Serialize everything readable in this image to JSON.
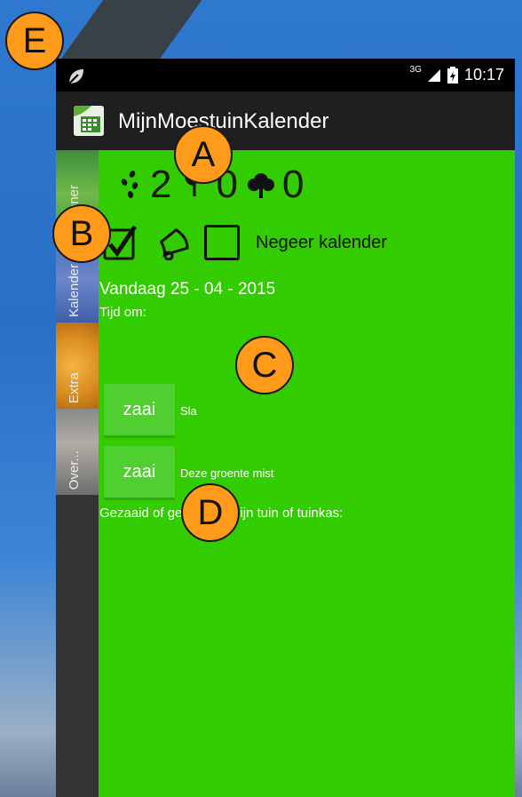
{
  "status_bar": {
    "network": "3G",
    "time": "10:17"
  },
  "app": {
    "title": "MijnMoestuinKalender"
  },
  "side_tabs": [
    "Planner",
    "Kalender",
    "Extra",
    "Over..."
  ],
  "counts": {
    "seed": "2",
    "sprout": "0",
    "tree": "0"
  },
  "negeer_label": "Negeer kalender",
  "today_label": "Vandaag 25 - 04 - 2015",
  "tijd_label": "Tijd om:",
  "tasks": [
    {
      "button": "zaai",
      "label": "Sla"
    },
    {
      "button": "zaai",
      "label": "Deze groente mist"
    }
  ],
  "gezaaid_label": "Gezaaid of geplant in mijn tuin of tuinkas:",
  "markers": {
    "a": "A",
    "b": "B",
    "c": "C",
    "d": "D",
    "e": "E"
  },
  "colors": {
    "content_bg": "#33cc00",
    "marker": "#ff9a1a"
  }
}
